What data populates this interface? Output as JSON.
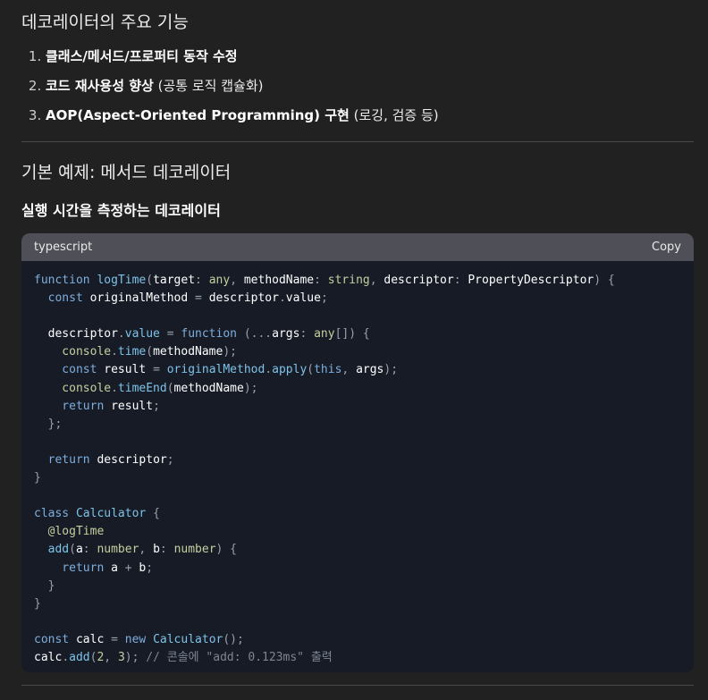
{
  "features_heading": "데코레이터의 주요 기능",
  "features": [
    {
      "bold": "클래스/메서드/프로퍼티 동작 수정",
      "rest": ""
    },
    {
      "bold": "코드 재사용성 향상",
      "rest": " (공통 로직 캡슐화)"
    },
    {
      "bold": "AOP(Aspect-Oriented Programming) 구현",
      "rest": " (로깅, 검증 등)"
    }
  ],
  "basic_heading": "기본 예제: 메서드 데코레이터",
  "exec_heading": "실행 시간을 측정하는 데코레이터",
  "code": {
    "language": "typescript",
    "copy_label": "Copy",
    "lines": [
      [
        {
          "t": "function ",
          "c": "k"
        },
        {
          "t": "logTime",
          "c": "f"
        },
        {
          "t": "(",
          "c": "p"
        },
        {
          "t": "target",
          "c": "v"
        },
        {
          "t": ": ",
          "c": "p"
        },
        {
          "t": "any",
          "c": "ty"
        },
        {
          "t": ", ",
          "c": "p"
        },
        {
          "t": "methodName",
          "c": "v"
        },
        {
          "t": ": ",
          "c": "p"
        },
        {
          "t": "string",
          "c": "ty"
        },
        {
          "t": ", ",
          "c": "p"
        },
        {
          "t": "descriptor",
          "c": "v"
        },
        {
          "t": ": ",
          "c": "p"
        },
        {
          "t": "PropertyDescriptor",
          "c": "v"
        },
        {
          "t": ") {",
          "c": "p"
        }
      ],
      [
        {
          "t": "  const ",
          "c": "k"
        },
        {
          "t": "originalMethod",
          "c": "v"
        },
        {
          "t": " = ",
          "c": "p"
        },
        {
          "t": "descriptor",
          "c": "v"
        },
        {
          "t": ".",
          "c": "p"
        },
        {
          "t": "value",
          "c": "v"
        },
        {
          "t": ";",
          "c": "p"
        }
      ],
      [],
      [
        {
          "t": "  descriptor",
          "c": "v"
        },
        {
          "t": ".",
          "c": "p"
        },
        {
          "t": "value",
          "c": "f"
        },
        {
          "t": " = ",
          "c": "p"
        },
        {
          "t": "function ",
          "c": "k"
        },
        {
          "t": "(...",
          "c": "p"
        },
        {
          "t": "args",
          "c": "v"
        },
        {
          "t": ": ",
          "c": "p"
        },
        {
          "t": "any",
          "c": "ty"
        },
        {
          "t": "[]) {",
          "c": "p"
        }
      ],
      [
        {
          "t": "    console",
          "c": "ty"
        },
        {
          "t": ".",
          "c": "p"
        },
        {
          "t": "time",
          "c": "f"
        },
        {
          "t": "(",
          "c": "p"
        },
        {
          "t": "methodName",
          "c": "v"
        },
        {
          "t": ");",
          "c": "p"
        }
      ],
      [
        {
          "t": "    const ",
          "c": "k"
        },
        {
          "t": "result",
          "c": "v"
        },
        {
          "t": " = ",
          "c": "p"
        },
        {
          "t": "originalMethod",
          "c": "f"
        },
        {
          "t": ".",
          "c": "p"
        },
        {
          "t": "apply",
          "c": "f"
        },
        {
          "t": "(",
          "c": "p"
        },
        {
          "t": "this",
          "c": "k"
        },
        {
          "t": ", ",
          "c": "p"
        },
        {
          "t": "args",
          "c": "v"
        },
        {
          "t": ");",
          "c": "p"
        }
      ],
      [
        {
          "t": "    console",
          "c": "ty"
        },
        {
          "t": ".",
          "c": "p"
        },
        {
          "t": "timeEnd",
          "c": "f"
        },
        {
          "t": "(",
          "c": "p"
        },
        {
          "t": "methodName",
          "c": "v"
        },
        {
          "t": ");",
          "c": "p"
        }
      ],
      [
        {
          "t": "    return ",
          "c": "k"
        },
        {
          "t": "result",
          "c": "v"
        },
        {
          "t": ";",
          "c": "p"
        }
      ],
      [
        {
          "t": "  };",
          "c": "p"
        }
      ],
      [],
      [
        {
          "t": "  return ",
          "c": "k"
        },
        {
          "t": "descriptor",
          "c": "v"
        },
        {
          "t": ";",
          "c": "p"
        }
      ],
      [
        {
          "t": "}",
          "c": "p"
        }
      ],
      [],
      [
        {
          "t": "class ",
          "c": "k"
        },
        {
          "t": "Calculator",
          "c": "f"
        },
        {
          "t": " {",
          "c": "p"
        }
      ],
      [
        {
          "t": "  @logTime",
          "c": "ty"
        }
      ],
      [
        {
          "t": "  add",
          "c": "f"
        },
        {
          "t": "(",
          "c": "p"
        },
        {
          "t": "a",
          "c": "v"
        },
        {
          "t": ": ",
          "c": "p"
        },
        {
          "t": "number",
          "c": "ty"
        },
        {
          "t": ", ",
          "c": "p"
        },
        {
          "t": "b",
          "c": "v"
        },
        {
          "t": ": ",
          "c": "p"
        },
        {
          "t": "number",
          "c": "ty"
        },
        {
          "t": ") {",
          "c": "p"
        }
      ],
      [
        {
          "t": "    return ",
          "c": "k"
        },
        {
          "t": "a",
          "c": "v"
        },
        {
          "t": " + ",
          "c": "p"
        },
        {
          "t": "b",
          "c": "v"
        },
        {
          "t": ";",
          "c": "p"
        }
      ],
      [
        {
          "t": "  }",
          "c": "p"
        }
      ],
      [
        {
          "t": "}",
          "c": "p"
        }
      ],
      [],
      [
        {
          "t": "const ",
          "c": "k"
        },
        {
          "t": "calc",
          "c": "v"
        },
        {
          "t": " = ",
          "c": "p"
        },
        {
          "t": "new ",
          "c": "k"
        },
        {
          "t": "Calculator",
          "c": "f"
        },
        {
          "t": "();",
          "c": "p"
        }
      ],
      [
        {
          "t": "calc",
          "c": "v"
        },
        {
          "t": ".",
          "c": "p"
        },
        {
          "t": "add",
          "c": "f"
        },
        {
          "t": "(",
          "c": "p"
        },
        {
          "t": "2",
          "c": "n"
        },
        {
          "t": ", ",
          "c": "p"
        },
        {
          "t": "3",
          "c": "n"
        },
        {
          "t": "); ",
          "c": "p"
        },
        {
          "t": "// 콘솔에 \"add: 0.123ms\" 출력",
          "c": "c"
        }
      ]
    ]
  }
}
